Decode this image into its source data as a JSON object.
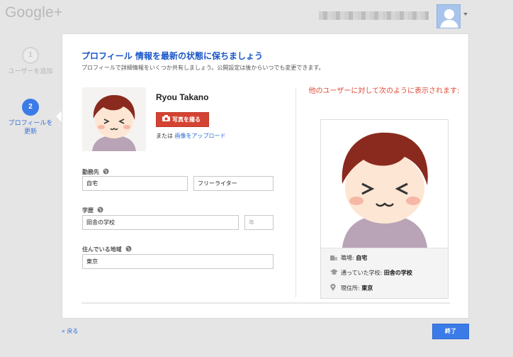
{
  "header": {
    "logo": "Google+",
    "account_menu_icon": "chevron-down-icon"
  },
  "steps": [
    {
      "number": "1",
      "label": "ユーザーを追加"
    },
    {
      "number": "2",
      "label": "プロフィールを更新"
    }
  ],
  "main": {
    "title": "プロフィール 情報を最新の状態に保ちましょう",
    "subtitle": "プロフィールで詳細情報をいくつか共有しましょう。公開設定は後からいつでも変更できます。",
    "name": "Ryou Takano",
    "photo_button_label": "写真を撮る",
    "upload_prefix": "または",
    "upload_link": "画像をアップロード",
    "work": {
      "label": "勤務先",
      "employer_value": "自宅",
      "title_value": "フリーライター"
    },
    "education": {
      "label": "学歴",
      "school_value": "田舎の学校",
      "year_placeholder": "年"
    },
    "location": {
      "label": "住んでいる地域",
      "value": "東京"
    }
  },
  "preview": {
    "title": "他のユーザーに対して次のように表示されます:",
    "work_label": "職場:",
    "work_value": "自宅",
    "school_label": "通っていた学校:",
    "school_value": "田舎の学校",
    "location_label": "現住所:",
    "location_value": "東京"
  },
  "footer": {
    "back_label": "« 戻る",
    "done_label": "終了"
  },
  "colors": {
    "accent_blue": "#3b7be8",
    "title_blue": "#1a56c6",
    "red": "#d44332",
    "preview_red": "#dd4b39"
  }
}
